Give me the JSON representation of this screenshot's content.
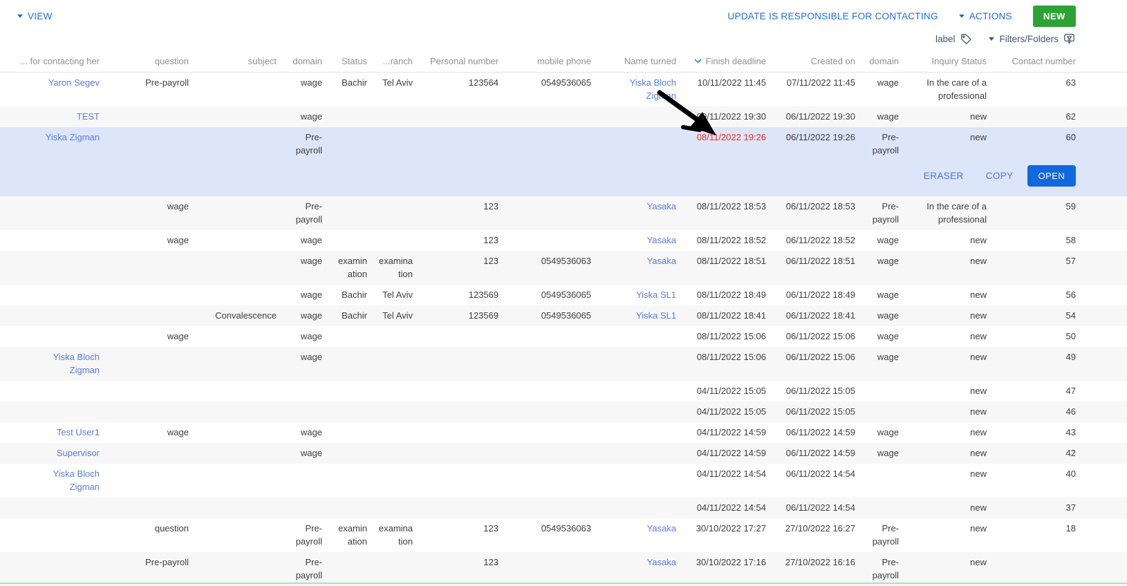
{
  "toolbar": {
    "view_label": "VIEW",
    "update_link": "UPDATE IS RESPONSIBLE FOR CONTACTING",
    "actions_label": "ACTIONS",
    "new_button": "NEW"
  },
  "filterbar": {
    "label_button": "label",
    "filters_label": "Filters/Folders"
  },
  "selected_row_actions": {
    "eraser": "ERASER",
    "copy": "COPY",
    "open": "OPEN"
  },
  "colors": {
    "action_blue": "#1b6ee5",
    "table_link_blue": "#5b7cd8",
    "new_green": "#2ea335",
    "open_blue": "#1268dd",
    "overdue_red": "#ee3124",
    "selected_row_bg": "#dde5f8",
    "stripe_gray": "#f7f7f7",
    "header_text": "#909090",
    "filter_text": "#44546f"
  },
  "icons": {
    "view_caret": "caret-down",
    "actions_caret": "caret-down",
    "filters_caret": "caret-down",
    "label_icon": "tag",
    "filters_icon": "folder-filter",
    "sort_icon": "chevron-down"
  },
  "annotation_arrow": {
    "shape": "hand-drawn-arrow",
    "color": "#000000",
    "points_at": "08/11/2022 19:26"
  },
  "table": {
    "columns": [
      {
        "key": "contacting",
        "label": "... for contacting her"
      },
      {
        "key": "question",
        "label": "question"
      },
      {
        "key": "subject",
        "label": "subject"
      },
      {
        "key": "domain",
        "label": "domain"
      },
      {
        "key": "status",
        "label": "Status"
      },
      {
        "key": "branch",
        "label": "...ranch"
      },
      {
        "key": "personal",
        "label": "Personal number"
      },
      {
        "key": "mobile",
        "label": "mobile phone"
      },
      {
        "key": "name",
        "label": "Name turned"
      },
      {
        "key": "deadline",
        "label": "Finish deadline",
        "sorted": "desc"
      },
      {
        "key": "created",
        "label": "Created on"
      },
      {
        "key": "domain2",
        "label": "domain"
      },
      {
        "key": "inquiry",
        "label": "Inquiry Status"
      },
      {
        "key": "contact",
        "label": "Contact number"
      }
    ],
    "rows": [
      {
        "bg": "white",
        "links": [
          "contacting",
          "name"
        ],
        "cells": {
          "contacting": "Yaron Segev",
          "question": "Pre-payroll",
          "subject": "",
          "domain": "wage",
          "status": "Bachir",
          "branch": "Tel Aviv",
          "personal": "123564",
          "mobile": "0549536065",
          "name": "Yiska Bloch Zigman",
          "deadline": "10/11/2022 11:45",
          "created": "07/11/2022 11:45",
          "domain2": "wage",
          "inquiry": "In the care of a professional",
          "contact": "63"
        }
      },
      {
        "bg": "gray",
        "links": [
          "contacting"
        ],
        "cells": {
          "contacting": "TEST",
          "question": "",
          "subject": "",
          "domain": "wage",
          "status": "",
          "branch": "",
          "personal": "",
          "mobile": "",
          "name": "",
          "deadline": "09/11/2022 19:30",
          "created": "06/11/2022 19:30",
          "domain2": "wage",
          "inquiry": "new",
          "contact": "62"
        }
      },
      {
        "bg": "selected",
        "selected": true,
        "deadline_red": true,
        "links": [
          "contacting"
        ],
        "cells": {
          "contacting": "Yiska Zigman",
          "question": "",
          "subject": "",
          "domain": "Pre-payroll",
          "status": "",
          "branch": "",
          "personal": "",
          "mobile": "",
          "name": "",
          "deadline": "08/11/2022 19:26",
          "created": "06/11/2022 19:26",
          "domain2": "Pre-payroll",
          "inquiry": "new",
          "contact": "60"
        }
      },
      {
        "bg": "gray",
        "links": [
          "name"
        ],
        "cells": {
          "contacting": "",
          "question": "wage",
          "subject": "",
          "domain": "Pre-payroll",
          "status": "",
          "branch": "",
          "personal": "123",
          "mobile": "",
          "name": "Yasaka",
          "deadline": "08/11/2022 18:53",
          "created": "06/11/2022 18:53",
          "domain2": "Pre-payroll",
          "inquiry": "In the care of a professional",
          "contact": "59"
        }
      },
      {
        "bg": "white",
        "links": [
          "name"
        ],
        "cells": {
          "contacting": "",
          "question": "wage",
          "subject": "",
          "domain": "wage",
          "status": "",
          "branch": "",
          "personal": "123",
          "mobile": "",
          "name": "Yasaka",
          "deadline": "08/11/2022 18:52",
          "created": "06/11/2022 18:52",
          "domain2": "wage",
          "inquiry": "new",
          "contact": "58"
        }
      },
      {
        "bg": "gray",
        "links": [
          "name"
        ],
        "cells": {
          "contacting": "",
          "question": "",
          "subject": "",
          "domain": "wage",
          "status": "examination",
          "branch": "examination",
          "personal": "123",
          "mobile": "0549536063",
          "name": "Yasaka",
          "deadline": "08/11/2022 18:51",
          "created": "06/11/2022 18:51",
          "domain2": "wage",
          "inquiry": "new",
          "contact": "57"
        }
      },
      {
        "bg": "white",
        "links": [
          "name"
        ],
        "cells": {
          "contacting": "",
          "question": "",
          "subject": "",
          "domain": "wage",
          "status": "Bachir",
          "branch": "Tel Aviv",
          "personal": "123569",
          "mobile": "0549536065",
          "name": "Yiska SL1",
          "deadline": "08/11/2022 18:49",
          "created": "06/11/2022 18:49",
          "domain2": "wage",
          "inquiry": "new",
          "contact": "56"
        }
      },
      {
        "bg": "gray",
        "links": [
          "name"
        ],
        "cells": {
          "contacting": "",
          "question": "",
          "subject": "Convalescence",
          "domain": "wage",
          "status": "Bachir",
          "branch": "Tel Aviv",
          "personal": "123569",
          "mobile": "0549536065",
          "name": "Yiska SL1",
          "deadline": "08/11/2022 18:41",
          "created": "06/11/2022 18:41",
          "domain2": "wage",
          "inquiry": "new",
          "contact": "54"
        }
      },
      {
        "bg": "white",
        "links": [],
        "cells": {
          "contacting": "",
          "question": "wage",
          "subject": "",
          "domain": "wage",
          "status": "",
          "branch": "",
          "personal": "",
          "mobile": "",
          "name": "",
          "deadline": "08/11/2022 15:06",
          "created": "06/11/2022 15:06",
          "domain2": "wage",
          "inquiry": "new",
          "contact": "50"
        }
      },
      {
        "bg": "gray",
        "links": [
          "contacting"
        ],
        "cells": {
          "contacting": "Yiska Bloch Zigman",
          "question": "",
          "subject": "",
          "domain": "wage",
          "status": "",
          "branch": "",
          "personal": "",
          "mobile": "",
          "name": "",
          "deadline": "08/11/2022 15:06",
          "created": "06/11/2022 15:06",
          "domain2": "wage",
          "inquiry": "new",
          "contact": "49"
        }
      },
      {
        "bg": "white",
        "links": [],
        "cells": {
          "contacting": "",
          "question": "",
          "subject": "",
          "domain": "",
          "status": "",
          "branch": "",
          "personal": "",
          "mobile": "",
          "name": "",
          "deadline": "04/11/2022 15:05",
          "created": "06/11/2022 15:05",
          "domain2": "",
          "inquiry": "new",
          "contact": "47"
        }
      },
      {
        "bg": "gray",
        "links": [],
        "cells": {
          "contacting": "",
          "question": "",
          "subject": "",
          "domain": "",
          "status": "",
          "branch": "",
          "personal": "",
          "mobile": "",
          "name": "",
          "deadline": "04/11/2022 15:05",
          "created": "06/11/2022 15:05",
          "domain2": "",
          "inquiry": "new",
          "contact": "46"
        }
      },
      {
        "bg": "white",
        "links": [
          "contacting"
        ],
        "cells": {
          "contacting": "Test User1",
          "question": "wage",
          "subject": "",
          "domain": "wage",
          "status": "",
          "branch": "",
          "personal": "",
          "mobile": "",
          "name": "",
          "deadline": "04/11/2022 14:59",
          "created": "06/11/2022 14:59",
          "domain2": "wage",
          "inquiry": "new",
          "contact": "43"
        }
      },
      {
        "bg": "gray",
        "links": [
          "contacting"
        ],
        "cells": {
          "contacting": "Supervisor",
          "question": "",
          "subject": "",
          "domain": "wage",
          "status": "",
          "branch": "",
          "personal": "",
          "mobile": "",
          "name": "",
          "deadline": "04/11/2022 14:59",
          "created": "06/11/2022 14:59",
          "domain2": "wage",
          "inquiry": "new",
          "contact": "42"
        }
      },
      {
        "bg": "white",
        "links": [
          "contacting"
        ],
        "cells": {
          "contacting": "Yiska Bloch Zigman",
          "question": "",
          "subject": "",
          "domain": "",
          "status": "",
          "branch": "",
          "personal": "",
          "mobile": "",
          "name": "",
          "deadline": "04/11/2022 14:54",
          "created": "06/11/2022 14:54",
          "domain2": "",
          "inquiry": "new",
          "contact": "40"
        }
      },
      {
        "bg": "gray",
        "links": [],
        "cells": {
          "contacting": "",
          "question": "",
          "subject": "",
          "domain": "",
          "status": "",
          "branch": "",
          "personal": "",
          "mobile": "",
          "name": "",
          "deadline": "04/11/2022 14:54",
          "created": "06/11/2022 14:54",
          "domain2": "",
          "inquiry": "new",
          "contact": "37"
        }
      },
      {
        "bg": "white",
        "links": [
          "name"
        ],
        "cells": {
          "contacting": "",
          "question": "question",
          "subject": "",
          "domain": "Pre-payroll",
          "status": "examination",
          "branch": "examination",
          "personal": "123",
          "mobile": "0549536063",
          "name": "Yasaka",
          "deadline": "30/10/2022 17:27",
          "created": "27/10/2022 16:27",
          "domain2": "Pre-payroll",
          "inquiry": "new",
          "contact": "18"
        }
      },
      {
        "bg": "gray",
        "links": [
          "name"
        ],
        "cells": {
          "contacting": "",
          "question": "Pre-payroll",
          "subject": "",
          "domain": "Pre-payroll",
          "status": "",
          "branch": "",
          "personal": "123",
          "mobile": "",
          "name": "Yasaka",
          "deadline": "30/10/2022 17:16",
          "created": "27/10/2022 16:16",
          "domain2": "Pre-payroll",
          "inquiry": "new",
          "contact": ""
        }
      }
    ]
  }
}
